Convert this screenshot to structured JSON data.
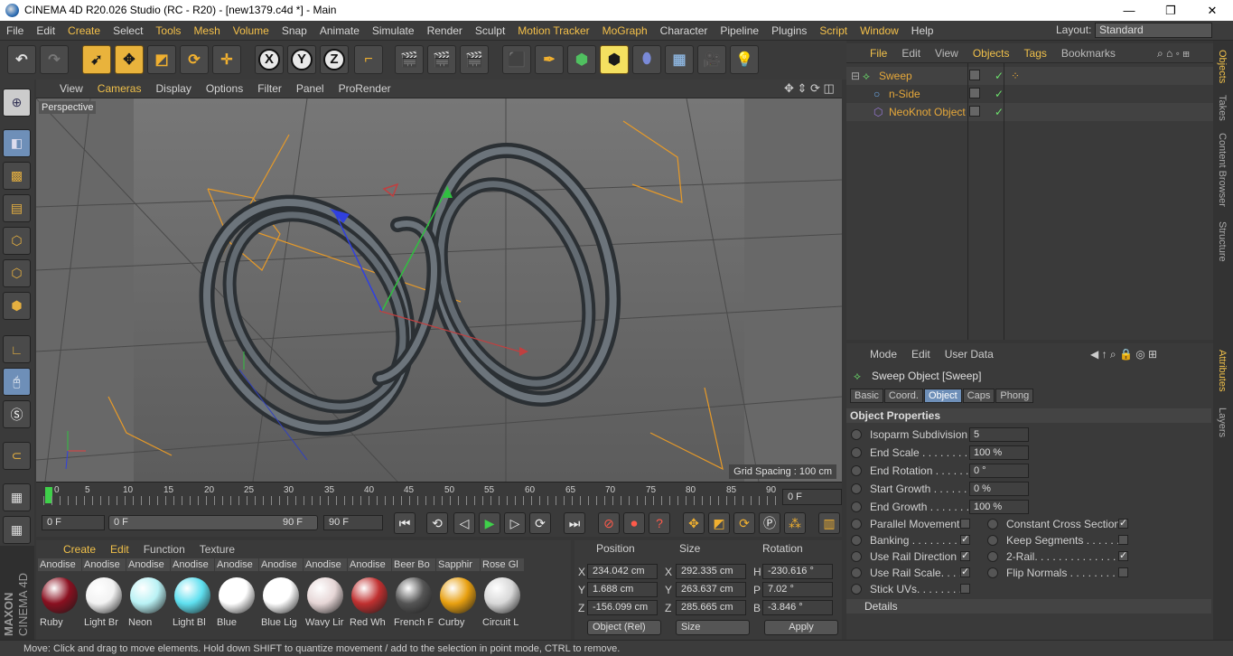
{
  "window": {
    "title": "CINEMA 4D R20.026 Studio (RC - R20) - [new1379.c4d *] - Main",
    "controls": {
      "minimize": "—",
      "maximize": "❐",
      "close": "✕"
    }
  },
  "menubar": {
    "items": [
      "File",
      "Edit",
      "Create",
      "Select",
      "Tools",
      "Mesh",
      "Volume",
      "Snap",
      "Animate",
      "Simulate",
      "Render",
      "Sculpt",
      "Motion Tracker",
      "MoGraph",
      "Character",
      "Pipeline",
      "Plugins",
      "Script",
      "Window",
      "Help"
    ],
    "layout_label": "Layout:",
    "layout_value": "Standard"
  },
  "toolbar": {
    "axis": [
      "X",
      "Y",
      "Z"
    ]
  },
  "viewport": {
    "menu": [
      "View",
      "Cameras",
      "Display",
      "Options",
      "Filter",
      "Panel",
      "ProRender"
    ],
    "label": "Perspective",
    "grid_spacing": "Grid Spacing : 100 cm"
  },
  "timeline": {
    "ticks": [
      "0",
      "5",
      "10",
      "15",
      "20",
      "25",
      "30",
      "35",
      "40",
      "45",
      "50",
      "55",
      "60",
      "65",
      "70",
      "75",
      "80",
      "85",
      "90"
    ],
    "current_frame": "0 F"
  },
  "transport": {
    "start": "0 F",
    "range_start": "0 F",
    "range_end": "90 F",
    "end": "90 F"
  },
  "materials": {
    "menu": [
      "Create",
      "Edit",
      "Function",
      "Texture"
    ],
    "items": [
      {
        "tab": "Anodise",
        "label": "Ruby",
        "color": "#8a1020"
      },
      {
        "tab": "Anodise",
        "label": "Light Br",
        "color": "#f2f2f2"
      },
      {
        "tab": "Anodise",
        "label": "Neon",
        "color": "#b9f2f5"
      },
      {
        "tab": "Anodise",
        "label": "Light Bl",
        "color": "#5fe0f0"
      },
      {
        "tab": "Anodise",
        "label": "Blue",
        "color": "#ffffff"
      },
      {
        "tab": "Anodise",
        "label": "Blue Lig",
        "color": "#ffffff"
      },
      {
        "tab": "Anodise",
        "label": "Wavy Lir",
        "color": "#e6d6d6"
      },
      {
        "tab": "Anodise",
        "label": "Red Wh",
        "color": "#c03030"
      },
      {
        "tab": "Beer Bo",
        "label": "French F",
        "color": "#555555"
      },
      {
        "tab": "Sapphir",
        "label": "Curby",
        "color": "#e8a010"
      },
      {
        "tab": "Rose Gl",
        "label": "Circuit L",
        "color": "#d8d8d8"
      }
    ]
  },
  "coordinates": {
    "headers": [
      "Position",
      "Size",
      "Rotation"
    ],
    "rows": [
      {
        "a1": "X",
        "pos": "234.042 cm",
        "a2": "X",
        "size": "292.335 cm",
        "a3": "H",
        "rot": "-230.616 °"
      },
      {
        "a1": "Y",
        "pos": "1.688 cm",
        "a2": "Y",
        "size": "263.637 cm",
        "a3": "P",
        "rot": "7.02 °"
      },
      {
        "a1": "Z",
        "pos": "-156.099 cm",
        "a2": "Z",
        "size": "285.665 cm",
        "a3": "B",
        "rot": "-3.846 °"
      }
    ],
    "mode": "Object (Rel)",
    "size_mode": "Size",
    "apply": "Apply"
  },
  "objects": {
    "menu": [
      "File",
      "Edit",
      "View",
      "Objects",
      "Tags",
      "Bookmarks"
    ],
    "items": [
      "Sweep",
      "n-Side",
      "NeoKnot Object"
    ]
  },
  "attributes": {
    "menu": [
      "Mode",
      "Edit",
      "User Data"
    ],
    "header": "Sweep Object [Sweep]",
    "tabs": [
      "Basic",
      "Coord.",
      "Object",
      "Caps",
      "Phong"
    ],
    "section": "Object Properties",
    "fields": [
      {
        "label": "Isoparm Subdivision",
        "value": "5"
      },
      {
        "label": "End Scale . . . . . . . . . .",
        "value": "100 %"
      },
      {
        "label": "End Rotation . . . . . .",
        "value": "0 °"
      },
      {
        "label": "Start Growth . . . . . .",
        "value": "0 %"
      },
      {
        "label": "End Growth . . . . . . .",
        "value": "100 %"
      }
    ],
    "checks_left": [
      {
        "label": "Parallel Movement",
        "checked": false
      },
      {
        "label": "Banking . . . . . . . .",
        "checked": true
      },
      {
        "label": "Use Rail Direction",
        "checked": true
      },
      {
        "label": "Use Rail Scale. . . .",
        "checked": true
      },
      {
        "label": "Stick UVs. . . . . . . .",
        "checked": false
      }
    ],
    "checks_right": [
      {
        "label": "Constant Cross Section",
        "checked": true
      },
      {
        "label": "Keep Segments . . . . . .",
        "checked": false
      },
      {
        "label": "2-Rail. . . . . . . . . . . . . .",
        "checked": true
      },
      {
        "label": "Flip Normals . . . . . . . . .",
        "checked": false
      }
    ],
    "details": "Details"
  },
  "right_tabs": [
    "Objects",
    "Takes",
    "Content Browser",
    "Structure",
    "Attributes",
    "Layers"
  ],
  "status": "Move: Click and drag to move elements. Hold down SHIFT to quantize movement / add to the selection in point mode, CTRL to remove.",
  "branding": {
    "maxon": "MAXON",
    "cinema": "CINEMA 4D"
  }
}
